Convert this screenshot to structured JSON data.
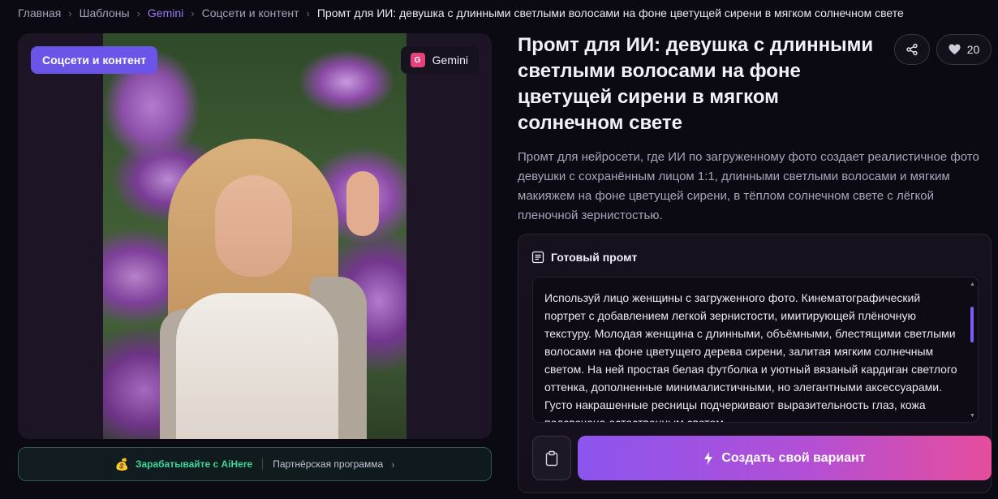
{
  "breadcrumb": {
    "items": [
      "Главная",
      "Шаблоны",
      "Gemini",
      "Соцсети и контент"
    ],
    "current": "Промт для ИИ: девушка с длинными светлыми волосами на фоне цветущей сирени в мягком солнечном свете"
  },
  "image": {
    "category_badge": "Соцсети и контент",
    "model_badge": {
      "icon_letter": "G",
      "label": "Gemini"
    }
  },
  "partner": {
    "coin_icon": "💰",
    "earn_label": "Зарабатывайте с AiHere",
    "program_label": "Партнёрская программа"
  },
  "title": "Промт для ИИ: девушка с длинными светлыми волосами на фоне цветущей сирени в мягком солнечном свете",
  "actions": {
    "likes": "20"
  },
  "description": "Промт для нейросети, где ИИ по загруженному фото создает реалистичное фото девушки с сохранённым лицом 1:1, длинными светлыми волосами и мягким макияжем на фоне цветущей сирени, в тёплом солнечном свете с лёгкой пленочной зернистостью.",
  "prompt": {
    "header": "Готовый промт",
    "text": "Используй лицо женщины с загруженного фото. Кинематографический портрет с добавлением легкой зернистости, имитирующей плёночную текстуру. Молодая женщина с длинными, объёмными, блестящими светлыми волосами на фоне цветущего дерева сирени, залитая мягким солнечным светом. На ней простая белая футболка и уютный вязаный кардиган светлого оттенка, дополненные минималистичными, но элегантными аксессуарами. Густо накрашенные ресницы подчеркивают выразительность глаз, кожа подсвечена естественным светом."
  },
  "cta": {
    "label": "Создать свой вариант"
  },
  "colors": {
    "accent": "#6a55e8",
    "gradient_start": "#8b55ee",
    "gradient_end": "#e64d9c",
    "earn_green": "#3fd69b",
    "gemini_icon": "#e8407a"
  }
}
